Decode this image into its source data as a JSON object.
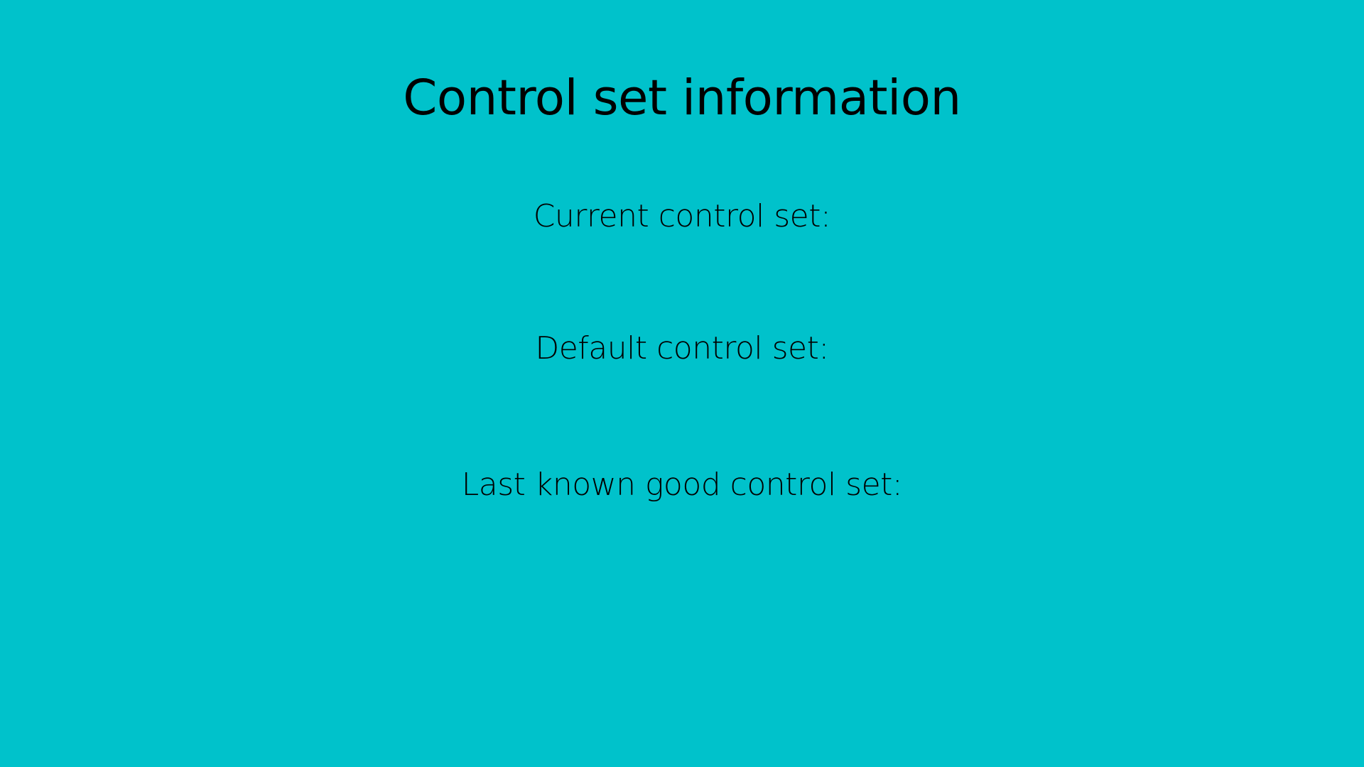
{
  "slide": {
    "title": "Control set information",
    "fields": {
      "current_label": "Current control set:",
      "default_label": "Default control set:",
      "last_known_good_label": "Last known good control set:"
    },
    "background_color": "#00c2cb",
    "text_color": "#000000"
  }
}
